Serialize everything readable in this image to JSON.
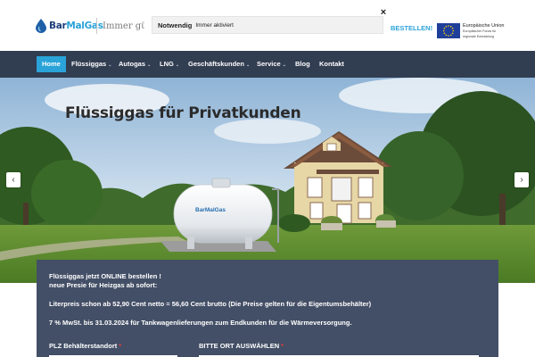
{
  "header": {
    "logo_text_primary": "Bar",
    "logo_text_accent": "MalGas",
    "tagline": "Immer günstig",
    "cookie_label": "Notwendig",
    "cookie_status": "Immer aktiviert",
    "close_symbol": "×",
    "order_link": "BESTELLEN!",
    "eu_title": "Europäische Union",
    "eu_subtitle_1": "Europäischer Fonds für",
    "eu_subtitle_2": "regionale Entwicklung"
  },
  "nav": {
    "items": [
      {
        "label": "Home",
        "active": true
      },
      {
        "label": "Flüssiggas",
        "dropdown": true
      },
      {
        "label": "Autogas",
        "dropdown": true
      },
      {
        "label": "LNG",
        "dropdown": true
      },
      {
        "label": "Geschäftskunden",
        "dropdown": true
      },
      {
        "label": "Service",
        "dropdown": true
      },
      {
        "label": "Blog"
      },
      {
        "label": "Kontakt"
      }
    ],
    "caret_symbol": "⌄"
  },
  "hero": {
    "title": "Flüssiggas für Privatkunden",
    "tank_logo": "BarMalGas",
    "prev_symbol": "‹",
    "next_symbol": "›"
  },
  "info": {
    "line1": "Flüssiggas jetzt ONLINE bestellen !",
    "line2": "neue Presie für Heizgas ab sofort:",
    "line3": "Literpreis schon ab 52,90 Cent netto = 56,60 Cent brutto (Die Preise gelten für die Eigentumsbehälter)",
    "line4": "7 % MwSt. bis 31.03.2024 für Tankwagenlieferungen zum Endkunden für die Wärmeversorgung."
  },
  "form": {
    "plz_label": "PLZ Behälterstandort",
    "ort_label": "BITTE ORT AUSWÄHLEN",
    "required_mark": "*"
  },
  "colors": {
    "nav_bg": "#313d51",
    "accent": "#2aa3d8",
    "info_bg": "#434f66",
    "required": "#e53b3b"
  }
}
